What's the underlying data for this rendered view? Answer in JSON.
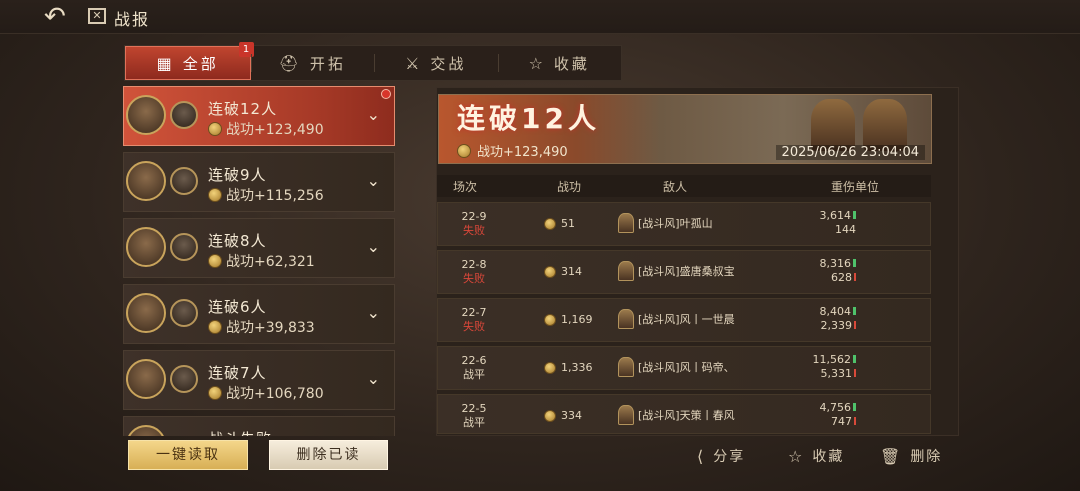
{
  "header": {
    "title": "战报",
    "back_icon": "back-arrow-icon",
    "title_icon": "report-icon"
  },
  "tabs": [
    {
      "label": "全部",
      "icon": "grid-icon",
      "active": true,
      "badge": "1"
    },
    {
      "label": "开拓",
      "icon": "helmet-icon",
      "active": false
    },
    {
      "label": "交战",
      "icon": "crossed-swords-icon",
      "active": false
    },
    {
      "label": "收藏",
      "icon": "star-icon",
      "active": false
    }
  ],
  "reports": [
    {
      "title": "连破12人",
      "merit": "战功+123,490",
      "active": true,
      "unread": true
    },
    {
      "title": "连破9人",
      "merit": "战功+115,256",
      "active": false
    },
    {
      "title": "连破8人",
      "merit": "战功+62,321",
      "active": false
    },
    {
      "title": "连破6人",
      "merit": "战功+39,833",
      "active": false
    },
    {
      "title": "连破7人",
      "merit": "战功+106,780",
      "active": false
    },
    {
      "title": "战斗失败",
      "merit": "",
      "active": false
    }
  ],
  "detail": {
    "banner_title": "连破12人",
    "banner_merit": "战功+123,490",
    "datetime": "2025/06/26 23:04:04",
    "columns": {
      "round": "场次",
      "merit": "战功",
      "enemy": "敌人",
      "casualties": "重伤单位"
    },
    "rows": [
      {
        "round": "22-9",
        "result": "失败",
        "merit": "51",
        "enemy": "[战斗风]叶孤山",
        "hurt_top": "3,614",
        "hurt_bottom": "144"
      },
      {
        "round": "22-8",
        "result": "失败",
        "merit": "314",
        "enemy": "[战斗风]盛唐桑叔宝",
        "hurt_top": "8,316",
        "hurt_bottom": "628"
      },
      {
        "round": "22-7",
        "result": "失败",
        "merit": "1,169",
        "enemy": "[战斗风]风丨一世晨",
        "hurt_top": "8,404",
        "hurt_bottom": "2,339"
      },
      {
        "round": "22-6",
        "result": "战平",
        "merit": "1,336",
        "enemy": "[战斗风]风丨码帝、",
        "hurt_top": "11,562",
        "hurt_bottom": "5,331"
      },
      {
        "round": "22-5",
        "result": "战平",
        "merit": "334",
        "enemy": "[战斗风]天策丨春风",
        "hurt_top": "4,756",
        "hurt_bottom": "747"
      }
    ]
  },
  "buttons": {
    "read_all": "一键读取",
    "delete_read": "删除已读"
  },
  "actions": {
    "share": "分享",
    "favorite": "收藏",
    "delete": "删除"
  },
  "colors": {
    "accent_red": "#c0452f",
    "gold": "#d8af55",
    "loss": "#d9473a"
  }
}
